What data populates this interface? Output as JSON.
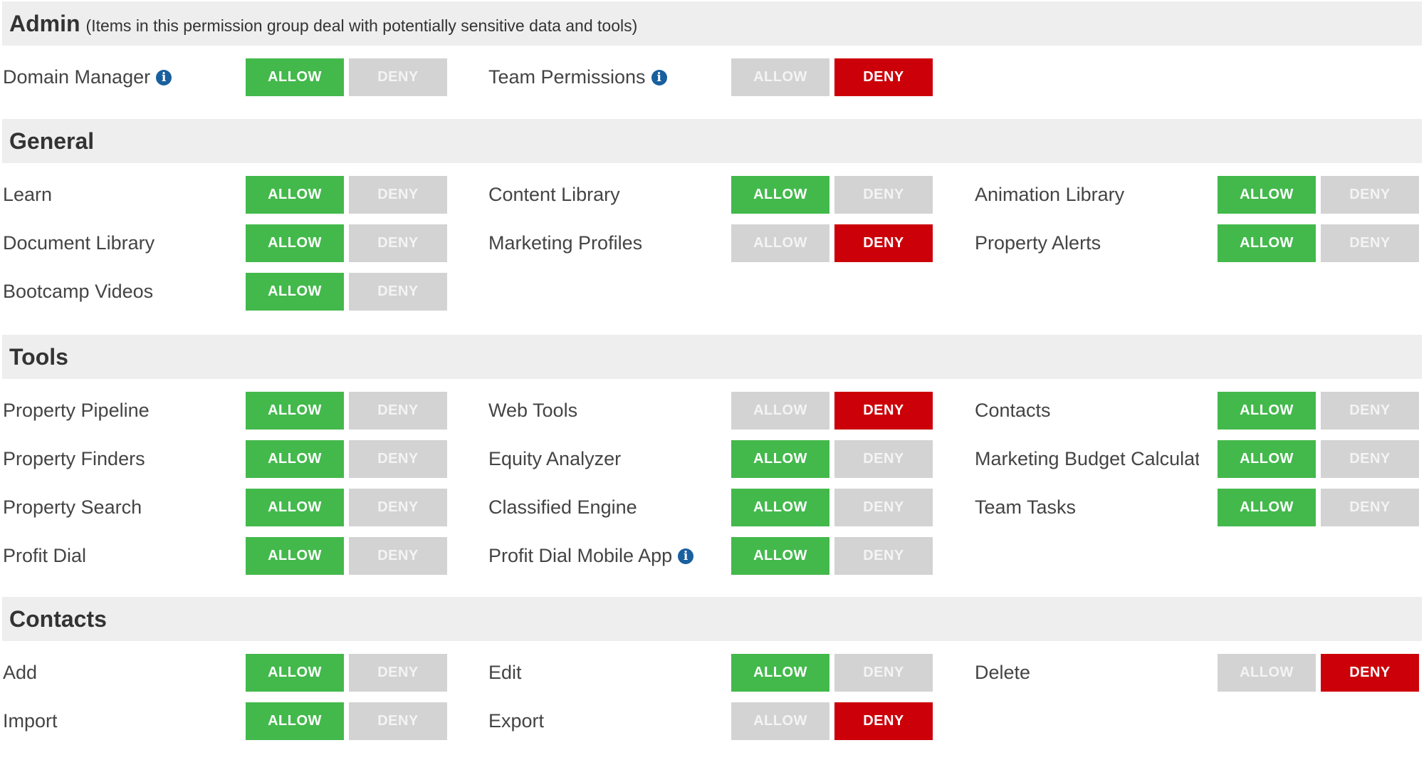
{
  "colors": {
    "allow_active": "#43b94c",
    "deny_active": "#cc0008",
    "inactive": "#d3d3d3",
    "header_bg": "#eeeeee",
    "info_icon": "#1a5f9e"
  },
  "button_labels": {
    "allow": "ALLOW",
    "deny": "DENY"
  },
  "info_icon_glyph": "i",
  "sections": [
    {
      "title": "Admin",
      "subtitle": "(Items in this permission group deal with potentially sensitive data and tools)",
      "rows": [
        [
          {
            "label": "Domain Manager",
            "info": true,
            "state": "allow"
          },
          {
            "label": "Team Permissions",
            "info": true,
            "state": "deny"
          }
        ]
      ]
    },
    {
      "title": "General",
      "subtitle": "",
      "rows": [
        [
          {
            "label": "Learn",
            "info": false,
            "state": "allow"
          },
          {
            "label": "Content Library",
            "info": false,
            "state": "allow"
          },
          {
            "label": "Animation Library",
            "info": false,
            "state": "allow"
          }
        ],
        [
          {
            "label": "Document Library",
            "info": false,
            "state": "allow"
          },
          {
            "label": "Marketing Profiles",
            "info": false,
            "state": "deny"
          },
          {
            "label": "Property Alerts",
            "info": false,
            "state": "allow"
          }
        ],
        [
          {
            "label": "Bootcamp Videos",
            "info": false,
            "state": "allow"
          }
        ]
      ]
    },
    {
      "title": "Tools",
      "subtitle": "",
      "rows": [
        [
          {
            "label": "Property Pipeline",
            "info": false,
            "state": "allow"
          },
          {
            "label": "Web Tools",
            "info": false,
            "state": "deny"
          },
          {
            "label": "Contacts",
            "info": false,
            "state": "allow"
          }
        ],
        [
          {
            "label": "Property Finders",
            "info": false,
            "state": "allow"
          },
          {
            "label": "Equity Analyzer",
            "info": false,
            "state": "allow"
          },
          {
            "label": "Marketing Budget Calculator",
            "info": false,
            "state": "allow"
          }
        ],
        [
          {
            "label": "Property Search",
            "info": false,
            "state": "allow"
          },
          {
            "label": "Classified Engine",
            "info": false,
            "state": "allow"
          },
          {
            "label": "Team Tasks",
            "info": false,
            "state": "allow"
          }
        ],
        [
          {
            "label": "Profit Dial",
            "info": false,
            "state": "allow"
          },
          {
            "label": "Profit Dial Mobile App",
            "info": true,
            "state": "allow"
          }
        ]
      ]
    },
    {
      "title": "Contacts",
      "subtitle": "",
      "rows": [
        [
          {
            "label": "Add",
            "info": false,
            "state": "allow"
          },
          {
            "label": "Edit",
            "info": false,
            "state": "allow"
          },
          {
            "label": "Delete",
            "info": false,
            "state": "deny"
          }
        ],
        [
          {
            "label": "Import",
            "info": false,
            "state": "allow"
          },
          {
            "label": "Export",
            "info": false,
            "state": "deny"
          }
        ]
      ]
    }
  ]
}
